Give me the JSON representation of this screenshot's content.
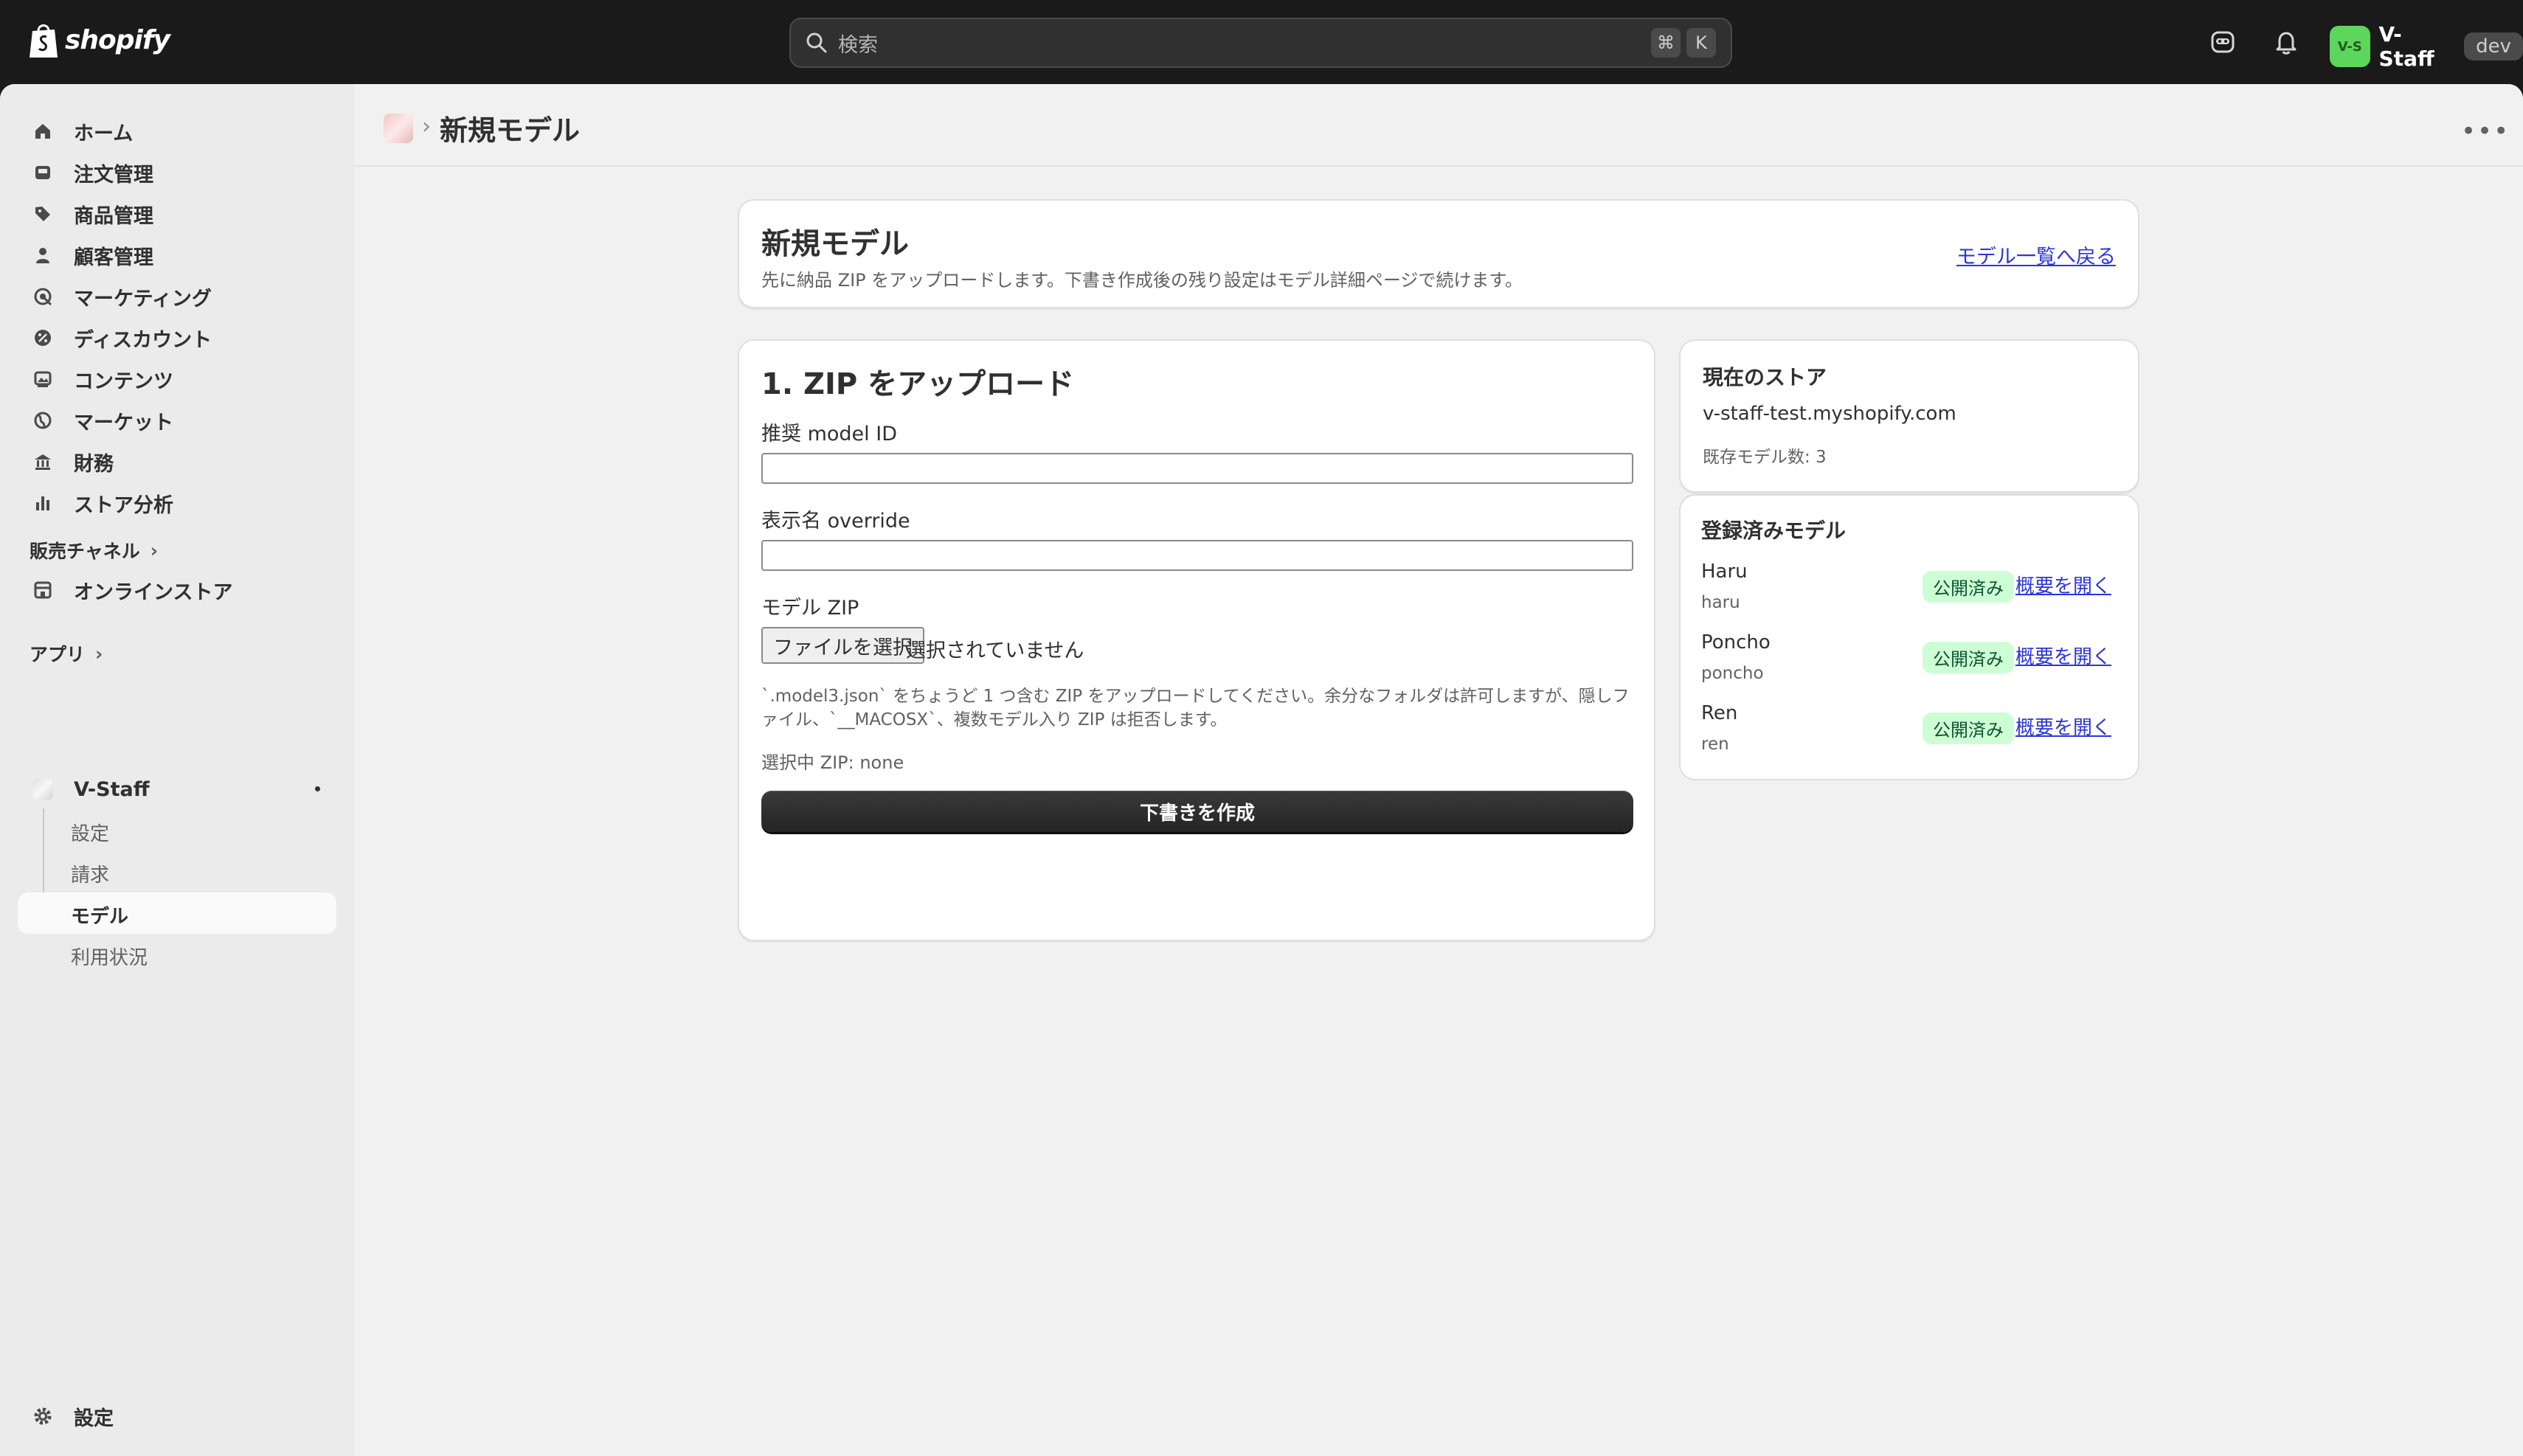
{
  "topbar": {
    "brand": "shopify",
    "search_placeholder": "検索",
    "shortcut_keys": [
      "⌘",
      "K"
    ],
    "store_avatar": "V-S",
    "store_name": "V-Staff",
    "env_badge": "dev"
  },
  "sidebar": {
    "items": [
      {
        "label": "ホーム",
        "icon": "home-icon"
      },
      {
        "label": "注文管理",
        "icon": "inbox-icon"
      },
      {
        "label": "商品管理",
        "icon": "tag-icon"
      },
      {
        "label": "顧客管理",
        "icon": "person-icon"
      },
      {
        "label": "マーケティング",
        "icon": "target-icon"
      },
      {
        "label": "ディスカウント",
        "icon": "discount-icon"
      },
      {
        "label": "コンテンツ",
        "icon": "image-icon"
      },
      {
        "label": "マーケット",
        "icon": "globe-icon"
      },
      {
        "label": "財務",
        "icon": "bank-icon"
      },
      {
        "label": "ストア分析",
        "icon": "chart-icon"
      }
    ],
    "sales_channels_label": "販売チャネル",
    "online_store_label": "オンラインストア",
    "apps_label": "アプリ",
    "app_name": "V-Staff",
    "app_sub_items": [
      "設定",
      "請求",
      "モデル",
      "利用状況"
    ],
    "settings_label": "設定"
  },
  "page": {
    "breadcrumb_title": "新規モデル"
  },
  "intro_card": {
    "title": "新規モデル",
    "description": "先に納品 ZIP をアップロードします。下書き作成後の残り設定はモデル詳細ページで続けます。",
    "back_link": "モデル一覧へ戻る"
  },
  "upload_card": {
    "title": "1. ZIP をアップロード",
    "model_id_label": "推奨 model ID",
    "model_id_value": "",
    "display_name_label": "表示名 override",
    "display_name_value": "",
    "zip_label": "モデル ZIP",
    "file_button": "ファイルを選択",
    "file_status": "選択されていません",
    "help_text": "`.model3.json` をちょうど 1 つ含む ZIP をアップロードしてください。余分なフォルダは許可しますが、隠しファイル、`__MACOSX`、複数モデル入り ZIP は拒否します。",
    "selected_zip": "選択中 ZIP: none",
    "submit_button": "下書きを作成"
  },
  "store_card": {
    "title": "現在のストア",
    "domain": "v-staff-test.myshopify.com",
    "model_count": "既存モデル数: 3"
  },
  "models_card": {
    "title": "登録済みモデル",
    "models": [
      {
        "name": "Haru",
        "handle": "haru",
        "status": "公開済み",
        "link": "概要を開く"
      },
      {
        "name": "Poncho",
        "handle": "poncho",
        "status": "公開済み",
        "link": "概要を開く"
      },
      {
        "name": "Ren",
        "handle": "ren",
        "status": "公開済み",
        "link": "概要を開く"
      }
    ]
  },
  "colors": {
    "topbar_bg": "#1a1a1a",
    "primary_button": "#303030",
    "published_badge_bg": "#cdfed4",
    "link": "#2a36d6",
    "avatar": "#5cd65c"
  }
}
